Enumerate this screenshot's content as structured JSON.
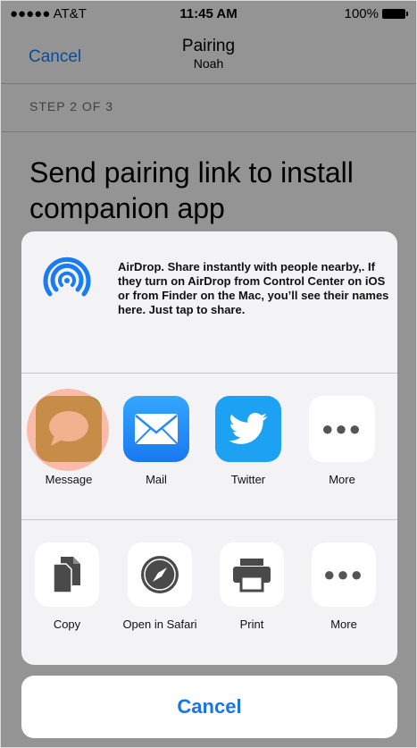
{
  "status_bar": {
    "carrier": "●●●●● AT&T",
    "time": "11:45 AM",
    "battery": "100%"
  },
  "nav": {
    "cancel_label": "Cancel",
    "title": "Pairing",
    "subtitle": "Noah"
  },
  "step_label": "STEP 2 OF 3",
  "heading": "Send pairing link to install companion app",
  "share_sheet": {
    "airdrop_text": "AirDrop. Share instantly with people nearby,. If they turn on AirDrop from Control Center on iOS or from Finder on the Mac, you’ll see their names here. Just tap to share.",
    "apps": [
      {
        "label": "Message",
        "icon": "message-icon"
      },
      {
        "label": "Mail",
        "icon": "mail-icon"
      },
      {
        "label": "Twitter",
        "icon": "twitter-icon"
      },
      {
        "label": "More",
        "icon": "more-icon"
      }
    ],
    "actions": [
      {
        "label": "Copy",
        "icon": "copy-icon"
      },
      {
        "label": "Open in Safari",
        "icon": "safari-icon"
      },
      {
        "label": "Print",
        "icon": "print-icon"
      },
      {
        "label": "More",
        "icon": "more-icon"
      }
    ]
  },
  "cancel_button": "Cancel",
  "colors": {
    "ios_blue": "#147efb",
    "message_green": "#7f8f1c",
    "twitter_blue": "#1da1f2"
  }
}
